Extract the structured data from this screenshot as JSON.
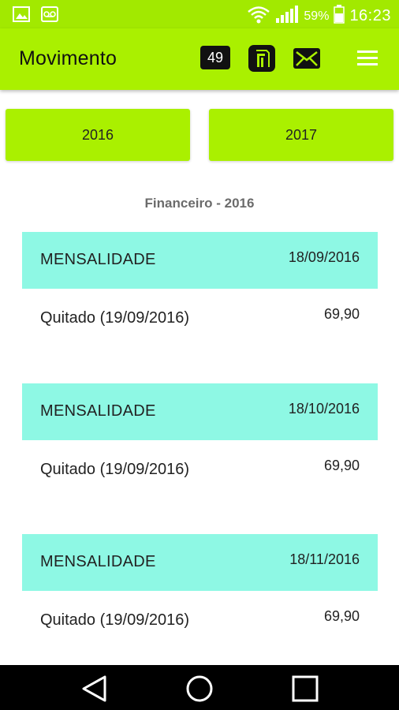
{
  "status_bar": {
    "battery": "59%",
    "time": "16:23",
    "left_icons": [
      "image-icon",
      "voicemail-icon"
    ],
    "right_icons": [
      "wifi-icon",
      "signal-icon",
      "battery-icon"
    ]
  },
  "app_bar": {
    "title": "Movimento",
    "badge_count": "49",
    "icons": [
      "document-icon",
      "mail-icon",
      "menu-icon"
    ]
  },
  "year_buttons": {
    "left": "2016",
    "right": "2017"
  },
  "section_title": "Financeiro - 2016",
  "entries": [
    {
      "type": "MENSALIDADE",
      "date": "18/09/2016",
      "status": "Quitado (19/09/2016)",
      "value": "69,90"
    },
    {
      "type": "MENSALIDADE",
      "date": "18/10/2016",
      "status": "Quitado (19/09/2016)",
      "value": "69,90"
    },
    {
      "type": "MENSALIDADE",
      "date": "18/11/2016",
      "status": "Quitado (19/09/2016)",
      "value": "69,90"
    }
  ],
  "nav_bar": {
    "icons": [
      "back-icon",
      "home-icon",
      "recents-icon"
    ]
  },
  "colors": {
    "accent": "#aaf000",
    "entry_header": "#8ef8e4",
    "section_title": "#6b6b6b"
  }
}
